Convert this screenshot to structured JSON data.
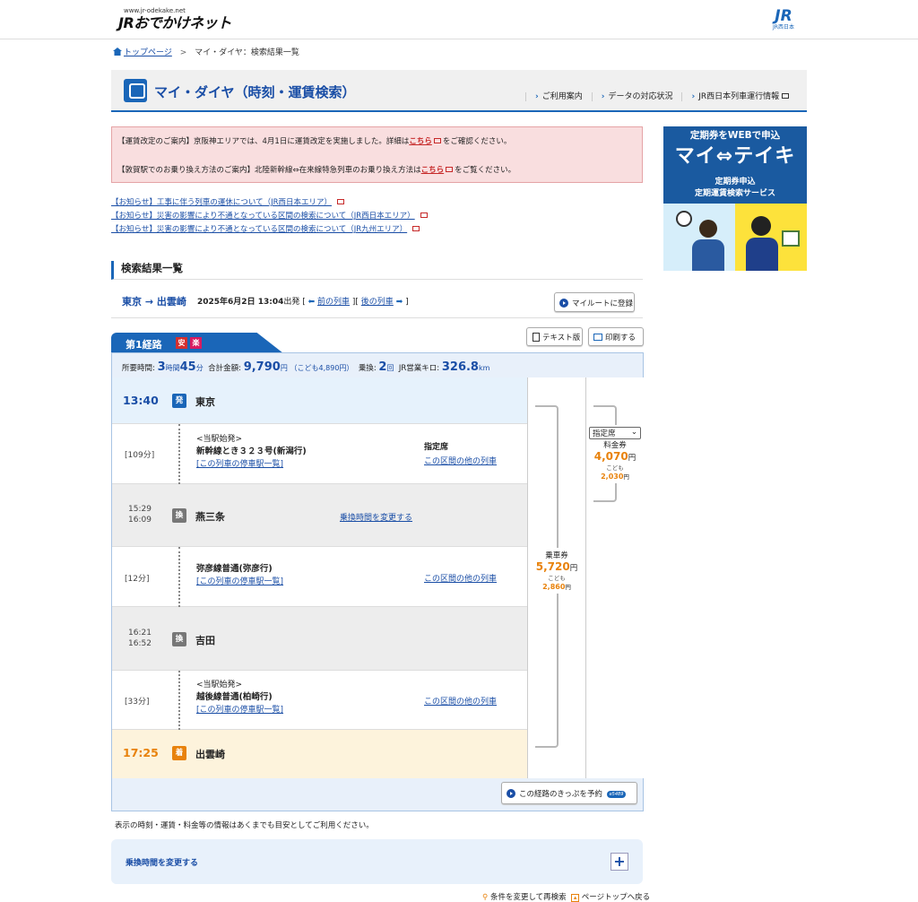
{
  "header": {
    "site_url": "www.jr-odekake.net",
    "site_name": "JRおでかけネット",
    "jr_logo": "JR",
    "jr_logo_sub": "JR西日本"
  },
  "breadcrumb": {
    "home": "トップページ",
    "separator": ">",
    "current": "マイ・ダイヤ：検索結果一覧"
  },
  "page": {
    "title": "マイ・ダイヤ（時刻・運賃検索）",
    "nav": [
      "ご利用案内",
      "データの対応状況",
      "JR西日本列車運行情報"
    ]
  },
  "notices": [
    {
      "before": "【運賃改定のご案内】京阪神エリアでは、4月1日に運賃改定を実施しました。詳細は",
      "link": "こちら",
      "after": "をご確認ください。"
    },
    {
      "before": "【敦賀駅でのお乗り換え方法のご案内】北陸新幹線⇔在来線特急列車のお乗り換え方法は",
      "link": "こちら",
      "after": "をご覧ください。"
    }
  ],
  "info_links": [
    "【お知らせ】工事に伴う列車の運休について（JR西日本エリア）",
    "【お知らせ】災害の影響により不通となっている区間の検索について（JR西日本エリア）",
    "【お知らせ】災害の影響により不通となっている区間の検索について（JR九州エリア）"
  ],
  "results": {
    "section_title": "検索結果一覧",
    "origin_dest": "東京 → 出雲崎",
    "date_time": "2025年6月2日 13:04",
    "departure_suffix": "出発",
    "prev_train": "前の列車",
    "next_train": "後の列車",
    "register_button": "マイルートに登録",
    "text_button": "テキスト版",
    "print_button": "印刷する"
  },
  "route": {
    "tab_label": "第1経路",
    "badge_safe": "安",
    "badge_easy": "楽",
    "summary": {
      "time_label": "所要時間:",
      "hours": "3",
      "hours_unit": "時間",
      "minutes": "45",
      "minutes_unit": "分",
      "total_label": "合計金額:",
      "total": "9,790",
      "yen": "円",
      "child_label": "（こども4,890円）",
      "transfer_label": "乗換:",
      "transfers": "2",
      "transfers_unit": "回",
      "km_label": "JR営業キロ:",
      "km": "326.8",
      "km_unit": "km"
    },
    "stops": [
      {
        "time": "13:40",
        "mark": "発",
        "name": "東京"
      },
      {
        "arr": "15:29",
        "dep": "16:09",
        "mark": "換",
        "name": "燕三条",
        "change_link": "乗換時間を変更する"
      },
      {
        "arr": "16:21",
        "dep": "16:52",
        "mark": "換",
        "name": "吉田"
      },
      {
        "time": "17:25",
        "mark": "着",
        "name": "出雲崎"
      }
    ],
    "legs": [
      {
        "duration": "[109分]",
        "origin_note": "<当駅始発>",
        "train": "新幹線とき３２３号(新潟行)",
        "stops_link": "[この列車の停車駅一覧]",
        "seat": "指定席",
        "other": "この区間の他の列車"
      },
      {
        "duration": "[12分]",
        "origin_note": "",
        "train": "弥彦線普通(弥彦行)",
        "stops_link": "[この列車の停車駅一覧]",
        "seat": "",
        "other": "この区間の他の列車"
      },
      {
        "duration": "[33分]",
        "origin_note": "<当駅始発>",
        "train": "越後線普通(柏崎行)",
        "stops_link": "[この列車の停車駅一覧]",
        "seat": "",
        "other": "この区間の他の列車"
      }
    ],
    "fare": {
      "label": "乗車券",
      "value": "5,720",
      "yen": "円",
      "child_label": "こども",
      "child_value": "2,860",
      "child_yen": "円"
    },
    "surcharge": {
      "select_value": "指定席",
      "label": "料金券",
      "value": "4,070",
      "yen": "円",
      "child_label": "こども",
      "child_value": "2,030",
      "child_yen": "円"
    },
    "book_button": "この経路のきっぷを予約",
    "book_logo": "e5489"
  },
  "footer": {
    "note": "表示の時刻・運賃・料金等の情報はあくまでも目安としてご利用ください。",
    "accordion_label": "乗換時間を変更する",
    "accordion_toggle": "+",
    "research": "条件を変更して再検索",
    "page_top": "ページトップへ戻る"
  },
  "ad": {
    "line1": "定期券をWEBで申込",
    "line2": "マイ⇔テイキ",
    "line3": "定期券申込",
    "line4": "定期運賃検索サービス"
  },
  "colors": {
    "accent": "#1a66b8",
    "fare": "#e8820c",
    "notice_bg": "#f9dedf",
    "arrival_bg": "#fdf3dc",
    "transfer_bg": "#ededed"
  }
}
